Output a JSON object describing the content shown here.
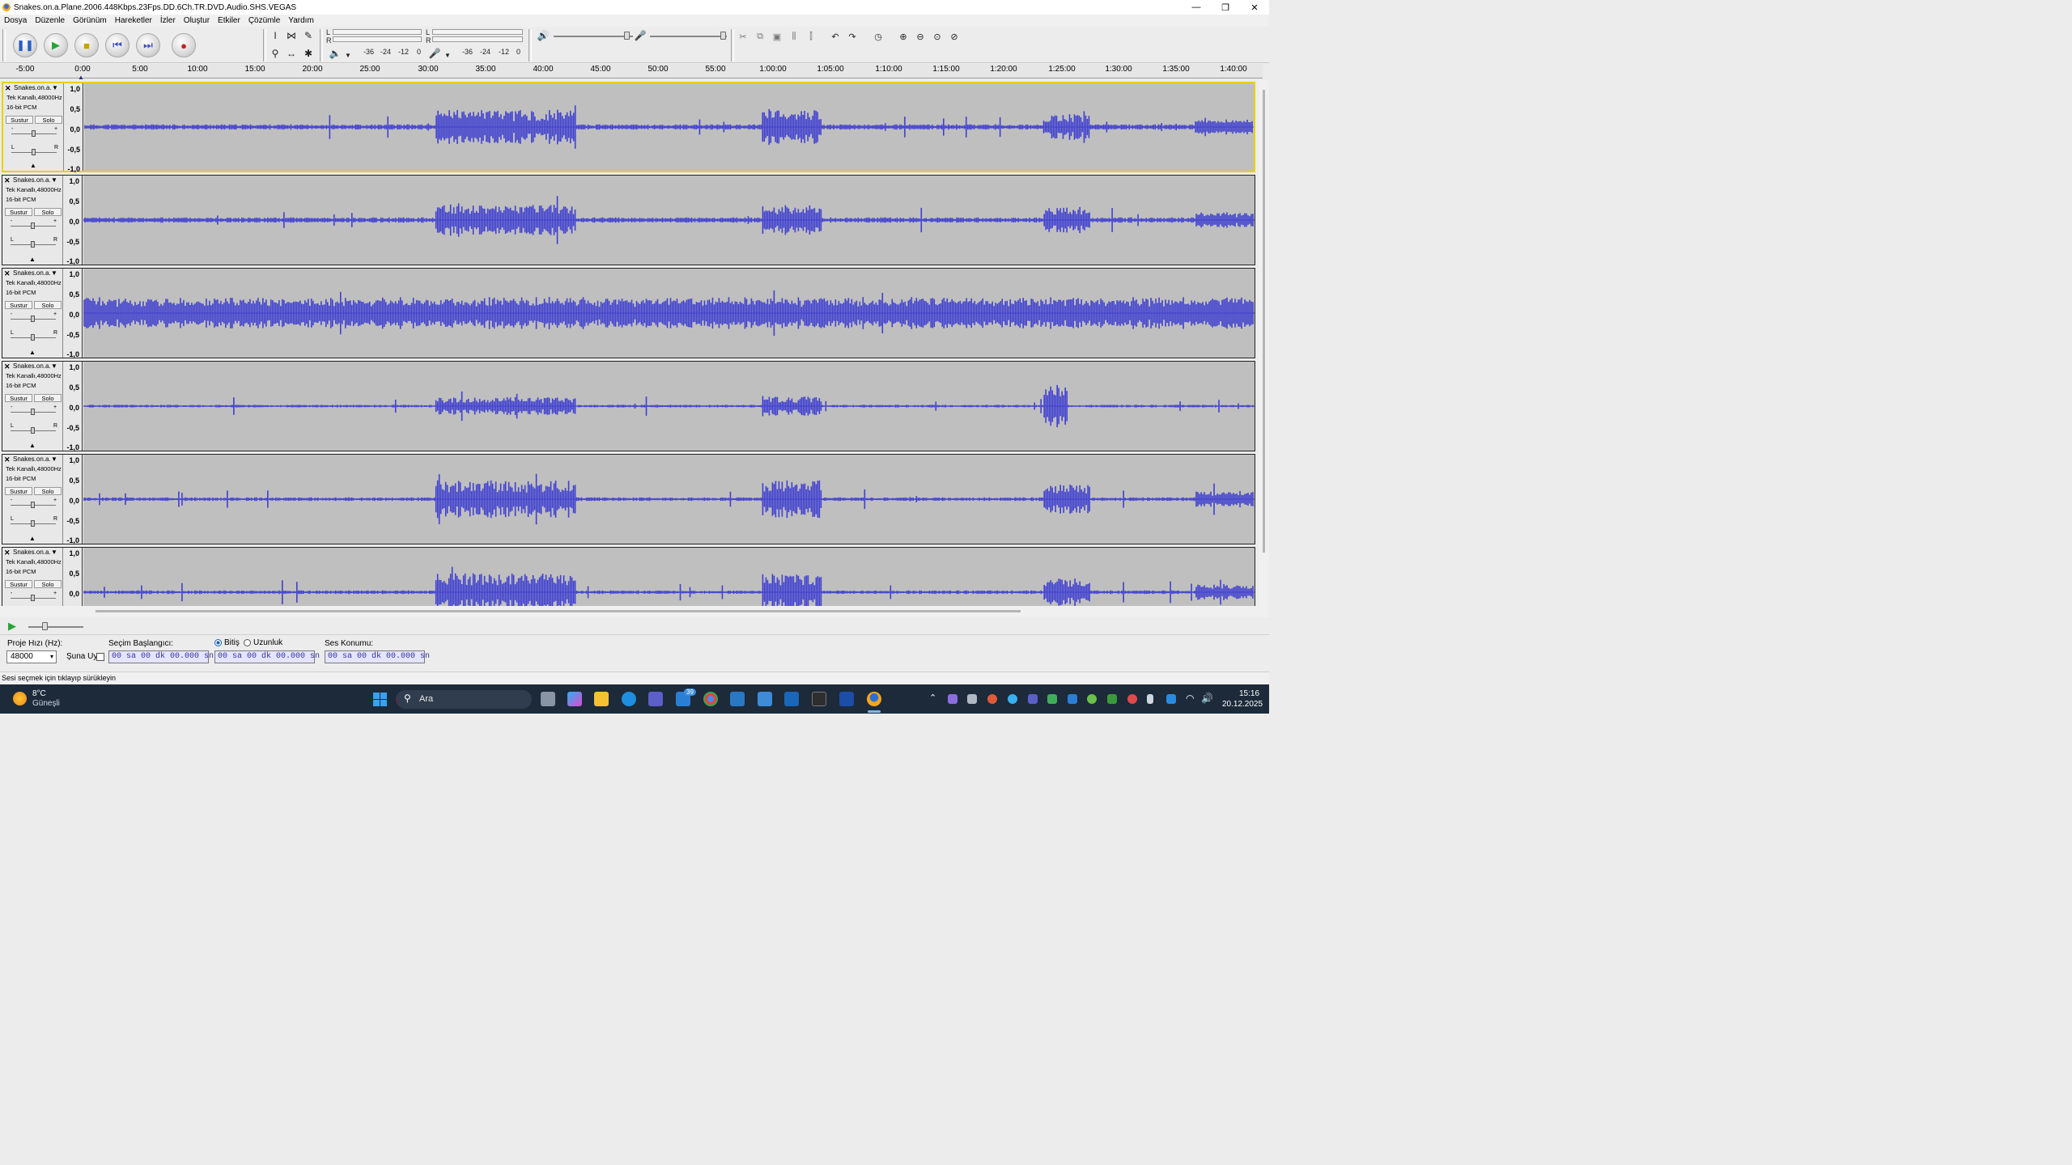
{
  "window": {
    "title": "Snakes.on.a.Plane.2006.448Kbps.23Fps.DD.6Ch.TR.DVD.Audio.SHS.VEGAS",
    "minimize": "—",
    "maximize": "❐",
    "close": "✕"
  },
  "menu": [
    "Dosya",
    "Düzenle",
    "Görünüm",
    "Hareketler",
    "İzler",
    "Oluştur",
    "Etkiler",
    "Çözümle",
    "Yardım"
  ],
  "meters": {
    "L": "L",
    "R": "R",
    "ticks": [
      "-36",
      "-24",
      "-12",
      "0"
    ]
  },
  "ruler": [
    "-5:00",
    "0:00",
    "5:00",
    "10:00",
    "15:00",
    "20:00",
    "25:00",
    "30:00",
    "35:00",
    "40:00",
    "45:00",
    "50:00",
    "55:00",
    "1:00:00",
    "1:05:00",
    "1:10:00",
    "1:15:00",
    "1:20:00",
    "1:25:00",
    "1:30:00",
    "1:35:00",
    "1:40:00"
  ],
  "tracks": [
    {
      "name": "Snakes.on.a.",
      "info": "Tek Kanallı,48000Hz",
      "format": "16-bit PCM",
      "mute": "Sustur",
      "solo": "Solo"
    },
    {
      "name": "Snakes.on.a.",
      "info": "Tek Kanallı,48000Hz",
      "format": "16-bit PCM",
      "mute": "Sustur",
      "solo": "Solo"
    },
    {
      "name": "Snakes.on.a.",
      "info": "Tek Kanallı,48000Hz",
      "format": "16-bit PCM",
      "mute": "Sustur",
      "solo": "Solo"
    },
    {
      "name": "Snakes.on.a.",
      "info": "Tek Kanallı,48000Hz",
      "format": "16-bit PCM",
      "mute": "Sustur",
      "solo": "Solo"
    },
    {
      "name": "Snakes.on.a.",
      "info": "Tek Kanallı,48000Hz",
      "format": "16-bit PCM",
      "mute": "Sustur",
      "solo": "Solo"
    },
    {
      "name": "Snakes.on.a.",
      "info": "Tek Kanallı,48000Hz",
      "format": "16-bit PCM",
      "mute": "Sustur",
      "solo": "Solo"
    }
  ],
  "vscale": [
    "1,0",
    "0,5",
    "0,0",
    "-0,5",
    "-1,0"
  ],
  "selection": {
    "rate_label": "Proje Hızı (Hz):",
    "rate_value": "48000",
    "snap_label": "Şuna Uy",
    "start_label": "Seçim Başlangıcı:",
    "end_label": "Bitiş",
    "length_label": "Uzunluk",
    "pos_label": "Ses Konumu:",
    "time_value": "00 sa 00 dk 00.000 sn"
  },
  "status": "Sesi seçmek için tıklayıp sürükleyin",
  "taskbar": {
    "temp": "8°C",
    "weather": "Güneşli",
    "search": "Ara",
    "time": "15:16",
    "date": "20.12.2025",
    "badge": "39"
  },
  "colors": {
    "wave": "#3f3fd0",
    "wave_bg": "#bfbfbf",
    "selected_border": "#e6d200"
  }
}
